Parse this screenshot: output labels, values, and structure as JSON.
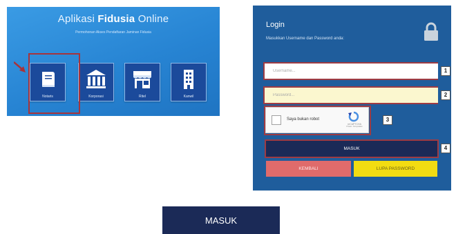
{
  "app_panel": {
    "title_prefix": "Aplikasi",
    "title_bold": "Fidusia",
    "title_suffix": "Online",
    "subtitle": "Permohonan Akses Pendaftaran Jaminan Fidusia",
    "tiles": [
      {
        "label": "Notaris",
        "icon": "book-icon",
        "selected": true
      },
      {
        "label": "Korporasi",
        "icon": "building-columns-icon"
      },
      {
        "label": "Ritel",
        "icon": "storefront-icon"
      },
      {
        "label": "Kanwil",
        "icon": "office-building-icon"
      }
    ]
  },
  "login": {
    "title": "Login",
    "subtitle": "Masukkan Username dan Password anda:",
    "username_placeholder": "Username...",
    "password_placeholder": "Password...",
    "recaptcha_label": "Saya bukan robot",
    "recaptcha_brand": "reCAPTCHA",
    "recaptcha_links": "Privasi - Persyaratan",
    "submit_label": "MASUK",
    "back_label": "KEMBALI",
    "forgot_label": "LUPA PASSWORD",
    "step_badges": [
      "1",
      "2",
      "3",
      "4"
    ]
  },
  "zoomed_button": {
    "label": "MASUK"
  },
  "colors": {
    "app_bg": "#2784d3",
    "tile_bg": "#1b4a9b",
    "login_bg": "#1f5d9c",
    "highlight": "#9e3b43",
    "masuk": "#1b2a57",
    "kembali": "#e06b6b",
    "lupa": "#f2dc12"
  }
}
